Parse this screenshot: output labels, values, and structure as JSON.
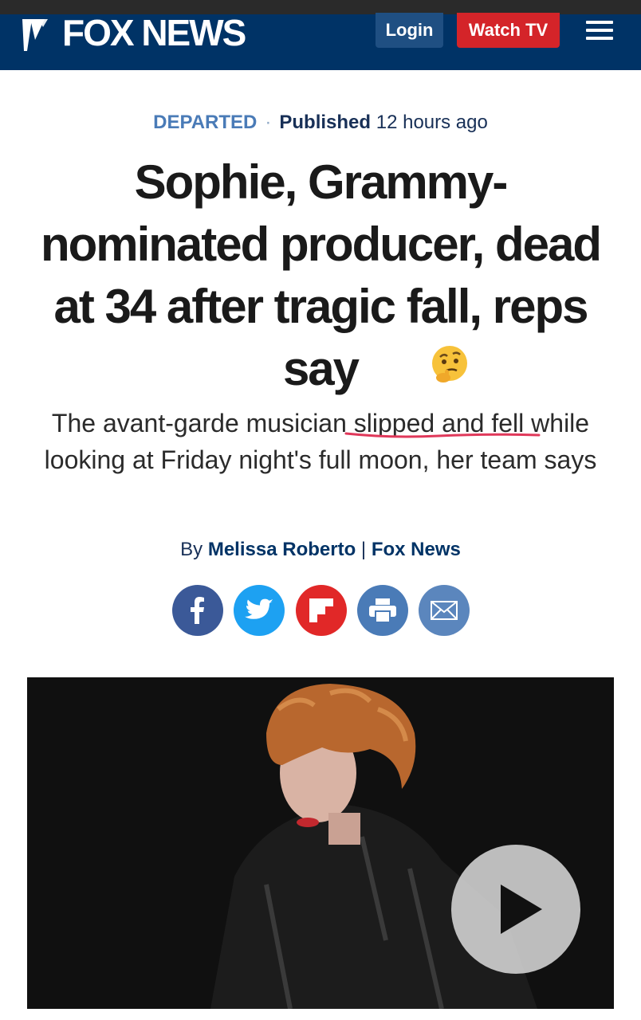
{
  "header": {
    "logo_text": "FOX NEWS",
    "login_label": "Login",
    "watch_label": "Watch TV",
    "brand_color": "#003366",
    "watch_color": "#d42429"
  },
  "article": {
    "category": "DEPARTED",
    "published_label": "Published",
    "published_time": "12 hours ago",
    "headline": "Sophie, Grammy-nominated producer, dead at 34 after tragic fall, reps say",
    "subhead_before": "The avant-garde musician ",
    "subhead_highlight": "slipped and fell",
    "subhead_after": " while looking at Friday night's full moon, her team says",
    "byline_prefix": "By ",
    "author": "Melissa Roberto",
    "byline_sep": " | ",
    "outlet": "Fox News"
  },
  "share": {
    "icons": [
      "facebook-icon",
      "twitter-icon",
      "flipboard-icon",
      "print-icon",
      "email-icon"
    ]
  },
  "emoji": "thinking-face-icon",
  "video": {
    "icon": "play-icon"
  }
}
